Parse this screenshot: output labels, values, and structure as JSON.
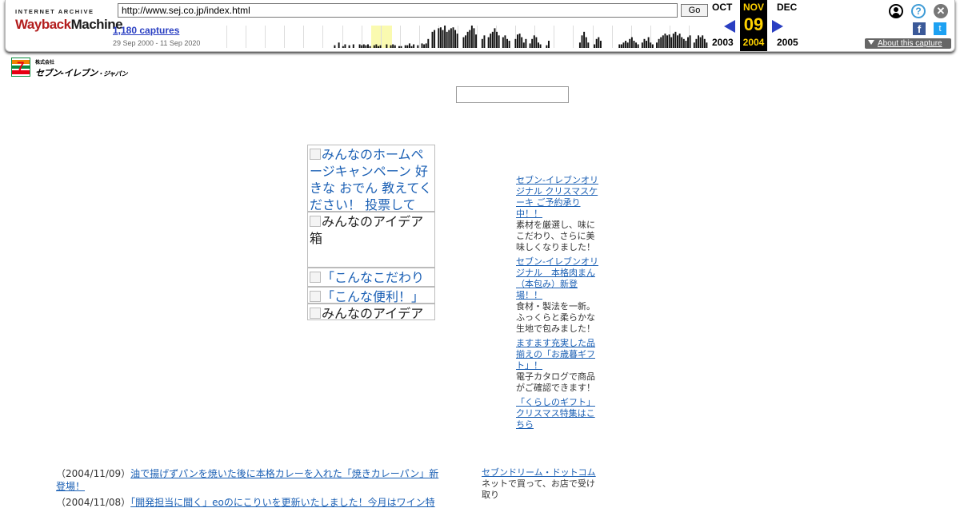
{
  "wayback": {
    "logo_top": "INTERNET ARCHIVE",
    "logo_main_a": "Wayback",
    "logo_main_b": "Machine",
    "url": "http://www.sej.co.jp/index.html",
    "go_label": "Go",
    "captures": "1,180 captures",
    "date_range": "29 Sep 2000 - 11 Sep 2020",
    "prev_month": "OCT",
    "cur_month": "NOV",
    "next_month": "DEC",
    "cur_day": "09",
    "prev_year": "2003",
    "cur_year": "2004",
    "next_year": "2005",
    "about_label": "About this capture",
    "help_glyph": "?",
    "close_glyph": "✕",
    "fb_glyph": "f",
    "tw_glyph": "t",
    "sparkline": [
      0,
      0,
      0,
      0,
      0,
      0,
      0,
      0,
      0,
      0,
      0,
      0,
      0,
      0,
      0,
      0,
      0,
      0,
      0,
      0,
      0,
      0,
      0,
      0,
      0,
      0,
      0,
      0,
      0,
      0,
      0,
      0,
      0,
      0,
      0,
      0,
      0,
      0,
      0,
      0,
      0,
      0,
      0,
      0,
      0,
      0,
      0,
      0,
      0,
      0,
      0,
      0,
      0,
      0,
      0,
      0,
      0,
      0,
      0,
      0,
      0,
      3,
      0,
      6,
      0,
      2,
      4,
      0,
      3,
      0,
      4,
      0,
      0,
      4,
      3,
      4,
      3,
      4,
      2,
      0,
      3,
      4,
      2,
      3,
      0,
      0,
      4,
      0,
      3,
      4,
      3,
      0,
      2,
      2,
      0,
      3,
      3,
      5,
      2,
      4,
      0,
      3,
      0,
      5,
      4,
      5,
      10,
      0,
      18,
      20,
      0,
      22,
      23,
      20,
      25,
      18,
      20,
      22,
      23,
      20,
      16,
      0,
      0,
      12,
      14,
      18,
      20,
      25,
      22,
      15,
      0,
      0,
      10,
      14,
      0,
      12,
      16,
      18,
      22,
      18,
      14,
      0,
      12,
      14,
      10,
      8,
      0,
      0,
      10,
      15,
      16,
      12,
      6,
      10,
      0,
      5,
      10,
      14,
      12,
      6,
      4,
      0,
      0,
      3,
      8,
      0,
      0,
      0,
      0,
      0,
      0,
      0,
      0,
      0,
      0,
      0,
      0,
      0,
      0,
      6,
      14,
      18,
      12,
      6,
      0,
      0,
      4,
      10,
      12,
      8,
      0,
      0,
      0,
      0,
      0,
      0,
      0,
      0,
      4,
      4,
      6,
      8,
      6,
      10,
      12,
      8,
      6,
      4,
      0,
      6,
      10,
      8,
      12,
      6,
      4,
      0,
      6,
      10,
      12,
      14,
      16,
      14,
      15,
      12,
      16,
      18,
      14,
      16,
      12,
      10,
      8,
      12,
      14,
      0,
      6,
      10,
      14,
      12,
      14,
      10,
      6
    ]
  },
  "site": {
    "logo_small": "株式会社",
    "logo_main": "セブン‐イレブン",
    "logo_sub": "・ジャパン",
    "logo_seven": "7"
  },
  "feature_images": [
    {
      "alt": "みんなのホームページキャンペーン 好きな おでん 教えてください！ 投票して",
      "link": true
    },
    {
      "alt": "みんなのアイデア箱",
      "link": false
    },
    {
      "alt": "「こんなこだわり",
      "link": true
    },
    {
      "alt": "「こんな便利！」",
      "link": true
    },
    {
      "alt": "みんなのアイデア",
      "link": false
    }
  ],
  "news": [
    {
      "title": "セブン‐イレブンオリジナル クリスマスケーキ ご予約承り中！！",
      "desc": "素材を厳選し、味にこだわり、さらに美味しくなりました！"
    },
    {
      "title": "セブン‐イレブンオリジナル　本格肉まん（本包み）新登場！！",
      "desc": "食材・製法を一新。ふっくらと柔らかな生地で包みました！"
    },
    {
      "title": "ますます充実した品揃えの「お歳暮ギフト」！",
      "desc": "電子カタログで商品がご確認できます！"
    },
    {
      "title": "「くらしのギフト」クリスマス特集はこちら",
      "desc": ""
    }
  ],
  "updates": [
    {
      "date": "（2004/11/09）",
      "text": "油で揚げずパンを焼いた後に本格カレーを入れた「焼きカレーパン」新登場！"
    },
    {
      "date": "（2004/11/08）",
      "text": "「開発担当に聞く」eoのにこりいを更新いたしました！今月はワイン特"
    }
  ],
  "promo": {
    "title": "セブンドリーム・ドットコム",
    "desc": "ネットで買って、お店で受け取り"
  }
}
